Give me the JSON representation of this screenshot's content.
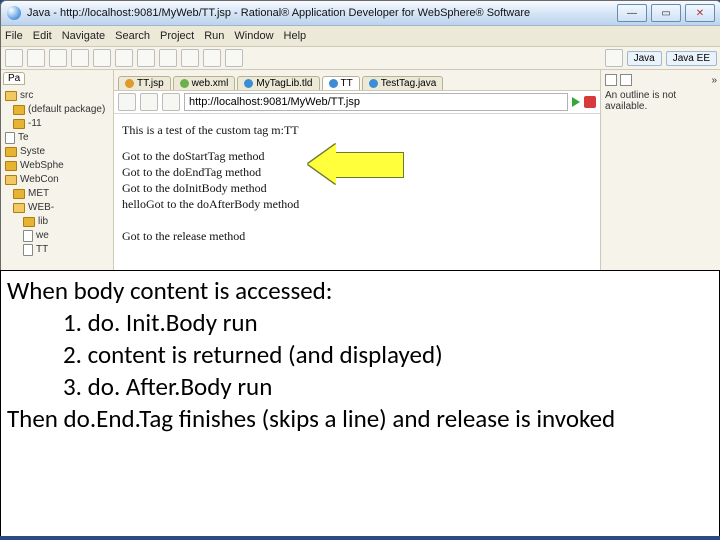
{
  "titlebar": {
    "title": "Java - http://localhost:9081/MyWeb/TT.jsp - Rational® Application Developer for WebSphere® Software"
  },
  "menubar": [
    "File",
    "Edit",
    "Navigate",
    "Search",
    "Project",
    "Run",
    "Window",
    "Help"
  ],
  "perspectives": {
    "java": "Java",
    "javaee": "Java EE"
  },
  "left_tab": "Pa",
  "tree": [
    "src",
    "(default package)",
    "-11",
    "Te",
    "Syste",
    "WebSphe",
    "WebCon",
    "MET",
    "WEB-",
    "lib",
    "we",
    "TT"
  ],
  "editor_tabs": [
    {
      "label": "TT.jsp",
      "active": false,
      "dot": "orange"
    },
    {
      "label": "web.xml",
      "active": false,
      "dot": "green"
    },
    {
      "label": "MyTagLib.tld",
      "active": false,
      "dot": "blue"
    },
    {
      "label": "TT",
      "active": true,
      "dot": "blue"
    },
    {
      "label": "TestTag.java",
      "active": false,
      "dot": "blue"
    }
  ],
  "url": {
    "value": "http://localhost:9081/MyWeb/TT.jsp"
  },
  "page": {
    "intro": "This is a test of the custom tag m:TT",
    "l1": "Got to the doStartTag method",
    "l2": "Got to the doEndTag method",
    "l3": "Got to the doInitBody method",
    "l4": "helloGot to the doAfterBody method",
    "l5": "Got to the release method"
  },
  "outline_more": "»",
  "outline": "An outline is not available.",
  "caption": {
    "h": "When body content is accessed:",
    "i1": "1. do. Init.Body run",
    "i2": "2. content is returned (and displayed)",
    "i3": "3. do. After.Body run",
    "t": "Then do.End.Tag finishes (skips a line) and release is invoked"
  }
}
